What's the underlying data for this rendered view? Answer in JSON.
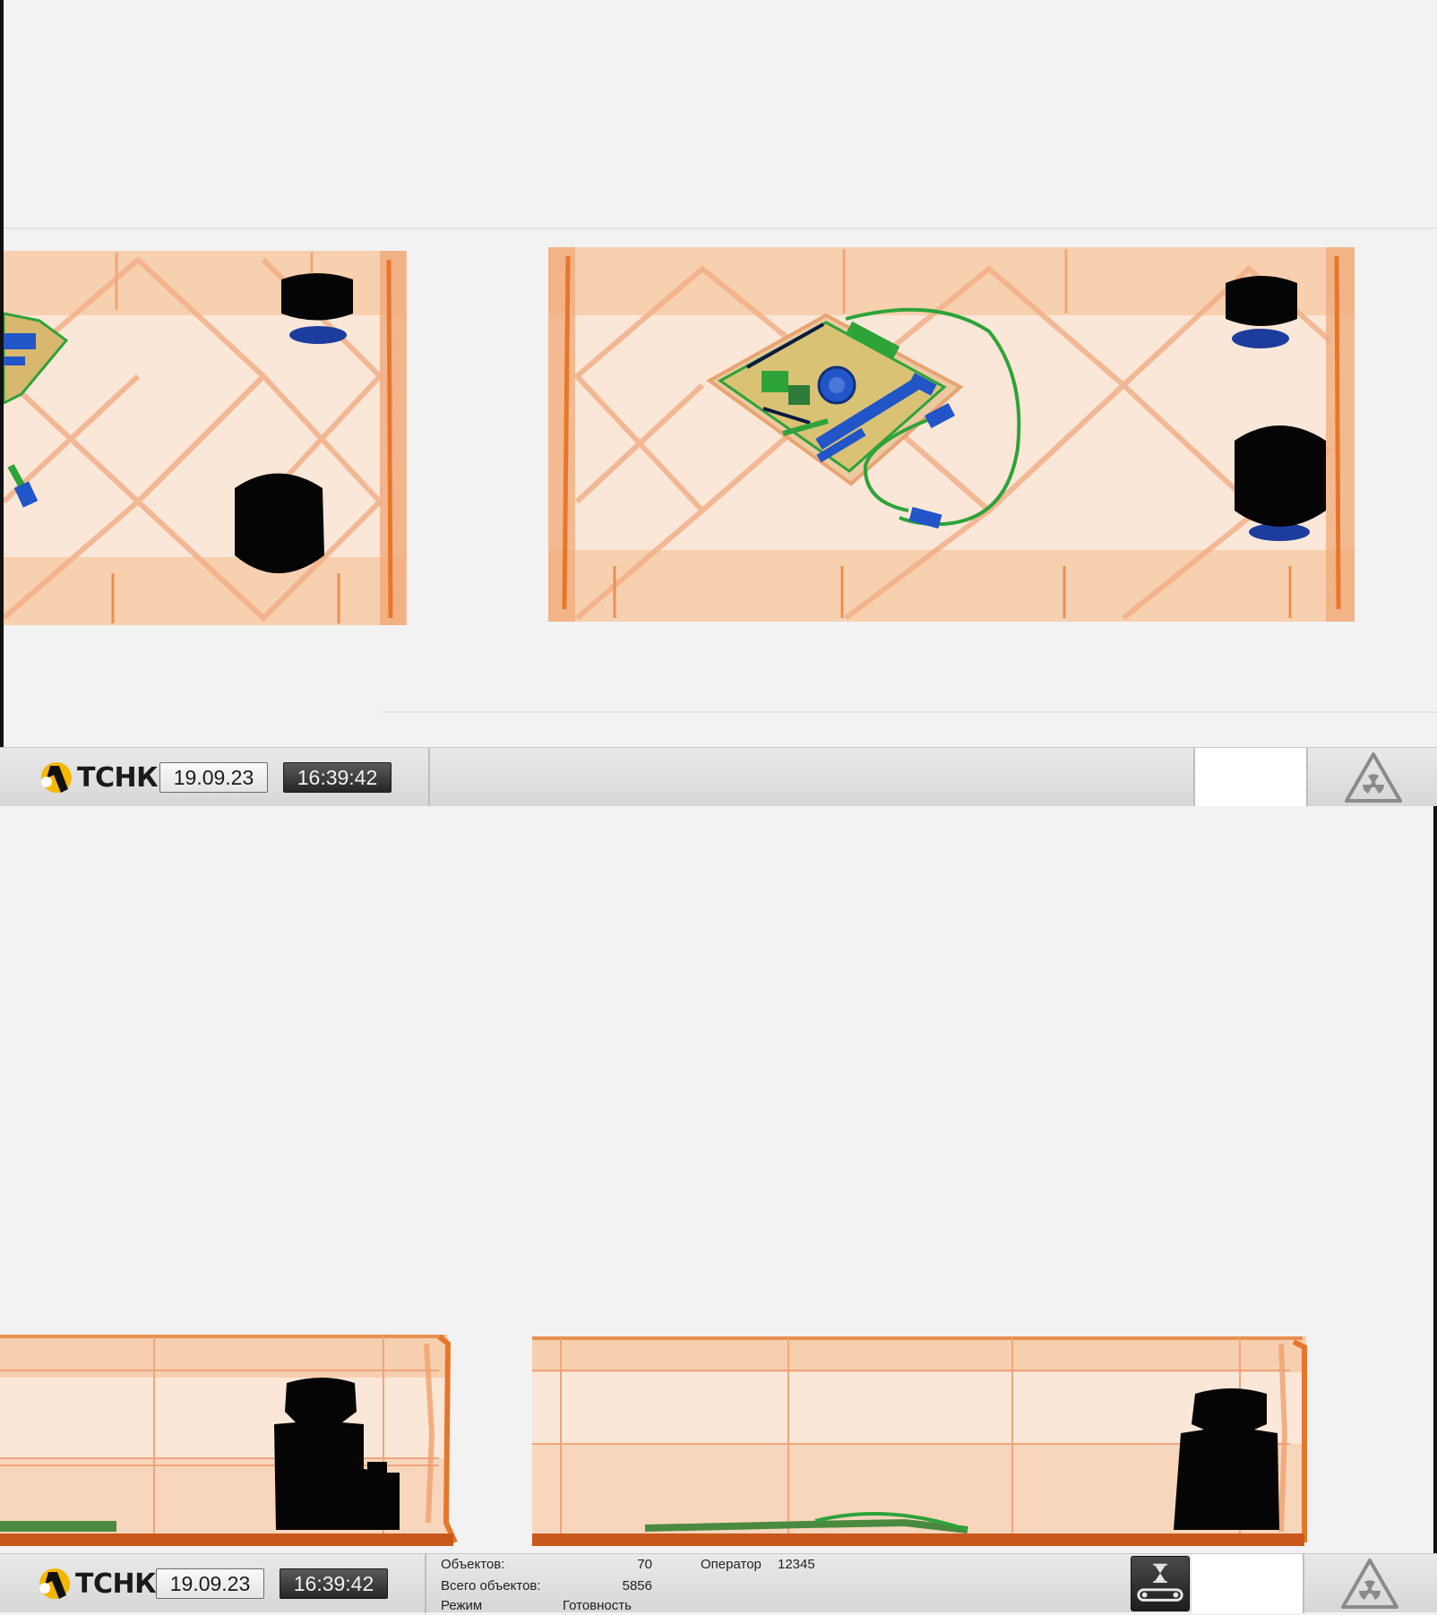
{
  "top_view": {
    "logo_text": "ТСНК",
    "date": "19.09.23",
    "time": "16:39:42",
    "icons": {
      "logo": "tsnk-logo-icon",
      "hazard": "radiation-warning-icon"
    }
  },
  "side_view": {
    "logo_text": "ТСНК",
    "date": "19.09.23",
    "time": "16:39:42",
    "objects_label": "Объектов:",
    "objects_value": "70",
    "total_objects_label": "Всего объектов:",
    "total_objects_value": "5856",
    "mode_label": "Режим",
    "mode_value": "Готовность",
    "operator_label": "Оператор",
    "operator_value": "12345",
    "icons": {
      "logo": "tsnk-logo-icon",
      "conveyor": "conveyor-hourglass-icon",
      "hazard": "radiation-warning-icon"
    }
  },
  "colors": {
    "background": "#f2f2f2",
    "organic_orange": "#e8762a",
    "mixed_green": "#2ea33a",
    "inorganic_blue": "#2255c8",
    "dense_black": "#050505"
  }
}
